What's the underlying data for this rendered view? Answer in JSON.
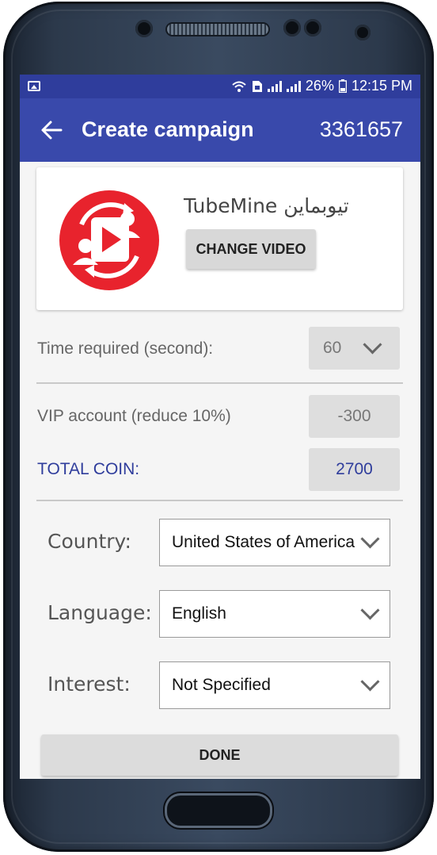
{
  "status_bar": {
    "battery": "26%",
    "time": "12:15 PM",
    "icons": [
      "image-icon",
      "wifi-icon",
      "sim-icon",
      "signal-icon",
      "signal-icon",
      "battery-icon"
    ]
  },
  "app_bar": {
    "title": "Create campaign",
    "coin_balance": "3361657",
    "color": "#3949ab"
  },
  "video_card": {
    "title": "TubeMine تیوبماین",
    "change_button": "CHANGE VIDEO",
    "logo_color": "#e8232d"
  },
  "time_required": {
    "label": "Time required (second):",
    "value": "60"
  },
  "vip": {
    "label": "VIP account (reduce 10%)",
    "value": "-300"
  },
  "total": {
    "label": "TOTAL COIN:",
    "value": "2700",
    "color": "#2f3d9c"
  },
  "country": {
    "label": "Country:",
    "value": "United States of America"
  },
  "language": {
    "label": "Language:",
    "value": "English"
  },
  "interest": {
    "label": "Interest:",
    "value": "Not Specified"
  },
  "done_button": "DONE"
}
